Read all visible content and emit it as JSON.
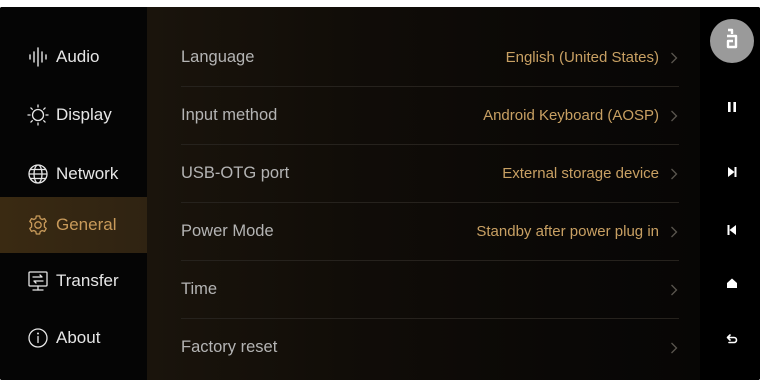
{
  "sidebar": {
    "items": [
      {
        "label": "Audio",
        "icon": "audio-waveform-icon",
        "active": false
      },
      {
        "label": "Display",
        "icon": "sun-icon",
        "active": false
      },
      {
        "label": "Network",
        "icon": "globe-icon",
        "active": false
      },
      {
        "label": "General",
        "icon": "gear-icon",
        "active": true
      },
      {
        "label": "Transfer",
        "icon": "transfer-icon",
        "active": false
      },
      {
        "label": "About",
        "icon": "info-icon",
        "active": false
      }
    ]
  },
  "settings": {
    "rows": [
      {
        "label": "Language",
        "value": "English (United States)"
      },
      {
        "label": "Input method",
        "value": "Android Keyboard (AOSP)"
      },
      {
        "label": "USB-OTG port",
        "value": "External storage device"
      },
      {
        "label": "Power Mode",
        "value": "Standby after power plug in"
      },
      {
        "label": "Time",
        "value": ""
      },
      {
        "label": "Factory reset",
        "value": ""
      }
    ]
  },
  "controls": {
    "items": [
      "avatar-icon",
      "pause-icon",
      "next-track-icon",
      "previous-track-icon",
      "home-icon",
      "back-icon"
    ]
  },
  "colors": {
    "accent": "#c8a063",
    "active_bg": "#3a2a12",
    "label": "#b4b4b4",
    "sidebar_text": "#e6e6e6"
  }
}
